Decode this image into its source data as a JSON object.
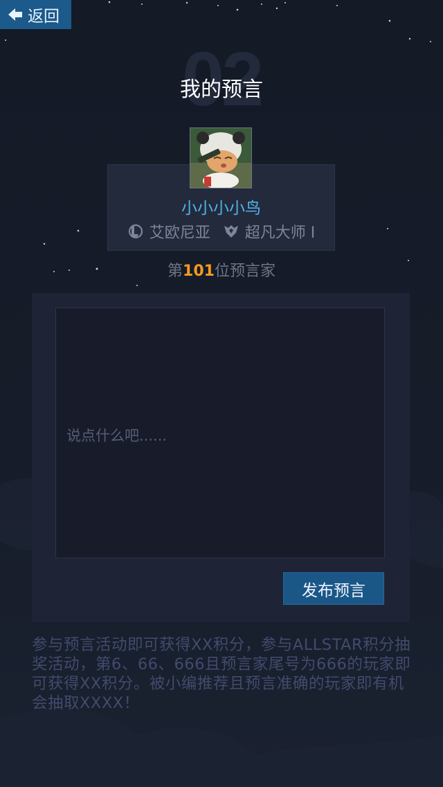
{
  "header": {
    "back_label": "返回"
  },
  "page": {
    "bg_number": "02",
    "title": "我的预言"
  },
  "profile": {
    "nickname": "小小小小鸟",
    "server": "艾欧尼亚",
    "rank": "超凡大师 I",
    "icons": {
      "server": "league-icon",
      "rank": "rank-badge-icon"
    }
  },
  "prophet_rank": {
    "prefix": "第",
    "number": "101",
    "suffix": "位预言家"
  },
  "form": {
    "placeholder": "说点什么吧......",
    "submit_label": "发布预言"
  },
  "rules": {
    "text": "参与预言活动即可获得XX积分，参与ALLSTAR积分抽奖活动，第6、66、666且预言家尾号为666的玩家即可获得XX积分。被小编推荐且预言准确的玩家即有机会抽取XXXX！"
  },
  "colors": {
    "background": "#151b27",
    "accent_blue": "#1b5a8a",
    "nickname_blue": "#4fb4ec",
    "rank_orange": "#f39a1e",
    "muted_text": "#414b6d"
  }
}
